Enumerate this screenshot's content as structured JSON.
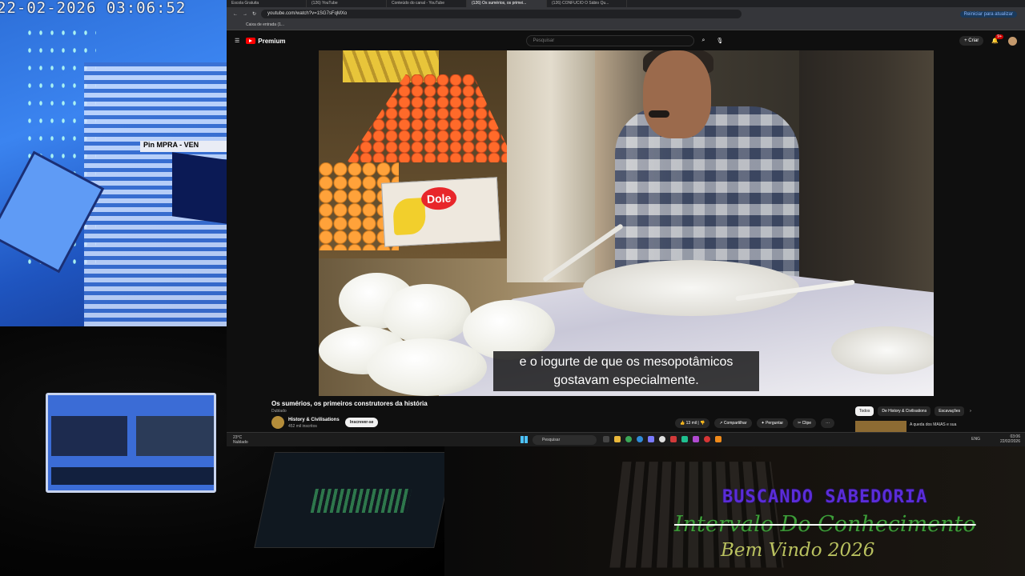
{
  "camera": {
    "timestamp": "22-02-2026 03:06:52",
    "sign_text": "Pin  MPRA - VEN"
  },
  "browser": {
    "tabs": [
      "Escola Gratuita",
      "(126) YouTube",
      "Conteúdo do canal - YouTube",
      "(126) Os sumérios, os primei...",
      "(126) CONFUCIO O Sábio Qu..."
    ],
    "active_tab_index": 3,
    "url": "youtube.com/watch?v=1SG7sFqMXo",
    "update_button": "Reiniciar para atualizar",
    "bookmark": "Caixa de entrada (1..."
  },
  "youtube": {
    "logo": "Premium",
    "search_placeholder": "Pesquisar",
    "create_label": "Criar",
    "notification_count": "9+",
    "subtitle_line1": "e o iogurte de que os mesopotâmicos",
    "subtitle_line2": "gostavam especialmente.",
    "video_title": "Os sumérios, os primeiros construtores da história",
    "dubbed_label": "Dublado",
    "channel_name": "History & Civilisations",
    "channel_subs": "452 mil inscritos",
    "subscribe_label": "Inscrever-se",
    "likes": "13 mil",
    "share_label": "Compartilhar",
    "ask_label": "Perguntar",
    "clip_label": "Clipe",
    "chips": [
      "Todos",
      "De History & Civilisations",
      "Escavações"
    ],
    "rec_title": "A queda dos MAIAS e sua"
  },
  "taskbar": {
    "temperature": "23°C",
    "weather": "Nublado",
    "search_label": "Pesquisar",
    "lang": "ENG",
    "time": "03:06",
    "date": "22/02/2026"
  },
  "overlay": {
    "line1": "BUSCANDO SABEDORIA",
    "line2": "Intervalo Do Conhecimento",
    "line3": "Bem Vindo 2026"
  },
  "colors": {
    "yt_red": "#ff0000",
    "overlay_purple": "#5a2cd9",
    "overlay_green": "#3e9c3a",
    "overlay_olive": "#b9c15f"
  }
}
